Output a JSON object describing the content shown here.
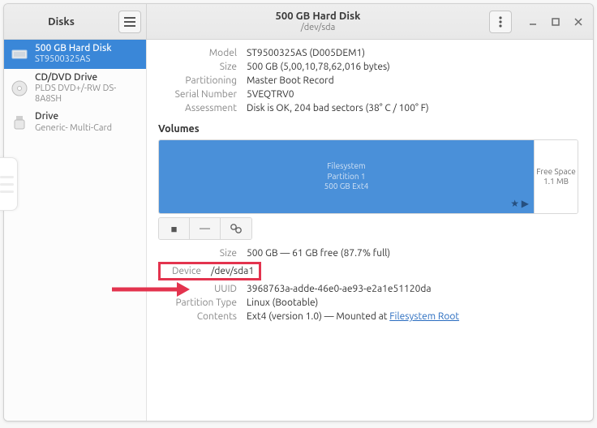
{
  "titlebar": {
    "left_title": "Disks",
    "center_title": "500 GB Hard Disk",
    "center_subtitle": "/dev/sda"
  },
  "sidebar": {
    "items": [
      {
        "name": "500 GB Hard Disk",
        "sub": "ST9500325AS"
      },
      {
        "name": "CD/DVD Drive",
        "sub": "PLDS DVD+/-RW DS-8A8SH"
      },
      {
        "name": "Drive",
        "sub": "Generic- Multi-Card"
      }
    ]
  },
  "disk": {
    "model_k": "Model",
    "model_v": "ST9500325AS (D005DEM1)",
    "size_k": "Size",
    "size_v": "500 GB (5,00,10,78,62,016 bytes)",
    "part_k": "Partitioning",
    "part_v": "Master Boot Record",
    "serial_k": "Serial Number",
    "serial_v": "5VEQTRV0",
    "assess_k": "Assessment",
    "assess_v": "Disk is OK, 204 bad sectors (38° C / 100° F)"
  },
  "volumes_header": "Volumes",
  "volume": {
    "line1": "Filesystem",
    "line2": "Partition 1",
    "line3": "500 GB Ext4",
    "free_l1": "Free Space",
    "free_l2": "1.1 MB"
  },
  "partition": {
    "size_k": "Size",
    "size_v": "500 GB — 61 GB free (87.7% full)",
    "device_k": "Device",
    "device_v": "/dev/sda1",
    "uuid_k": "UUID",
    "uuid_v": "3968763a-adde-46e0-ae93-e2a1e51120da",
    "ptype_k": "Partition Type",
    "ptype_v": "Linux (Bootable)",
    "contents_k": "Contents",
    "contents_pre": "Ext4 (version 1.0) — Mounted at ",
    "contents_link": "Filesystem Root"
  }
}
